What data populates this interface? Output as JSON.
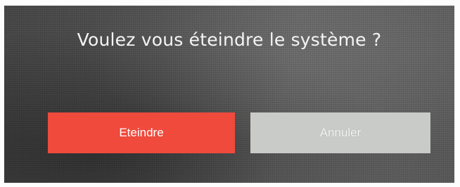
{
  "dialog": {
    "title": "Voulez vous éteindre le système ?",
    "buttons": {
      "confirm_label": "Eteindre",
      "cancel_label": "Annuler"
    }
  },
  "colors": {
    "confirm_bg": "#ef4a3c",
    "cancel_bg": "#c9cbc8",
    "text": "#f4f4f4"
  }
}
